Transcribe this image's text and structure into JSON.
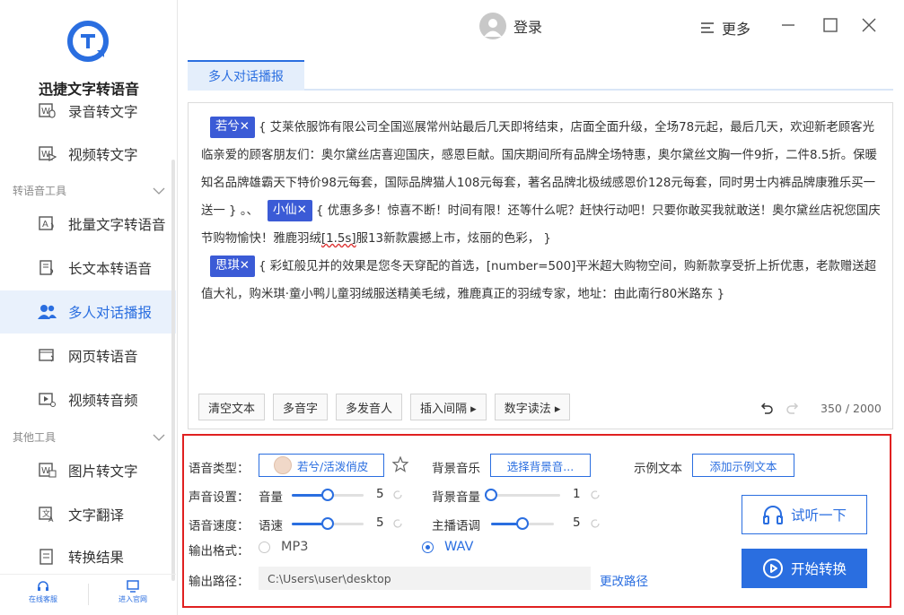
{
  "app": {
    "name": "迅捷文字转语音"
  },
  "header": {
    "login_label": "登录",
    "more_label": "更多"
  },
  "sidebar": {
    "items_top": [
      {
        "label": "录音转文字",
        "icon": "record-to-text-icon"
      },
      {
        "label": "视频转文字",
        "icon": "video-to-text-icon"
      }
    ],
    "section1": "转语音工具",
    "items_tts": [
      {
        "label": "批量文字转语音",
        "icon": "batch-tts-icon"
      },
      {
        "label": "长文本转语音",
        "icon": "long-text-icon"
      },
      {
        "label": "多人对话播报",
        "icon": "multi-speaker-icon",
        "active": true
      },
      {
        "label": "网页转语音",
        "icon": "web-tts-icon"
      },
      {
        "label": "视频转音频",
        "icon": "video-audio-icon"
      }
    ],
    "section2": "其他工具",
    "items_other": [
      {
        "label": "图片转文字",
        "icon": "image-text-icon"
      },
      {
        "label": "文字翻译",
        "icon": "translate-icon"
      },
      {
        "label": "转换结果",
        "icon": "results-icon"
      }
    ],
    "bottom": {
      "service": "在线客服",
      "website": "进入官网"
    }
  },
  "tab": {
    "label": "多人对话播报"
  },
  "editor": {
    "segments": [
      {
        "speaker": "若兮✕",
        "text": "{ 艾莱依服饰有限公司全国巡展常州站最后几天即将结束，店面全面升级，全场78元起，最后几天，欢迎新老顾客光临亲爱的顾客朋友们：奥尔黛丝店喜迎国庆，感恩巨献。国庆期间所有品牌全场特惠，奥尔黛丝文胸一件9折，二件8.5折。保暖知名品牌雄霸天下特价98元每套，国际品牌猫人108元每套，著名品牌北极绒感恩价128元每套，同时男士内裤品牌康雅乐买一送一 } 。、"
      },
      {
        "speaker": "小仙✕",
        "text_a": "{ 优惠多多！惊喜不断！时间有限！还等什么呢？赶快行动吧！只要你敢买我就敢送！奥尔黛丝店祝您国庆节购物愉快！雅鹿羽绒",
        "mark": "[1.5s]",
        "text_b": "服13新款震撼上市，炫丽的色彩， }"
      },
      {
        "speaker": "思琪✕",
        "text": "{ 彩虹般见并的效果是您冬天穿配的首选，[number=500]平米超大购物空间，购新款享受折上折优惠，老款赠送超值大礼，购米琪·童小鸭儿童羽绒服送精美毛绒，雅鹿真正的羽绒专家，地址：由此南行80米路东 }"
      }
    ],
    "tools": [
      "清空文本",
      "多音字",
      "多发音人",
      "插入间隔 ▸",
      "数字读法 ▸"
    ],
    "counter": "350 / 2000"
  },
  "settings": {
    "voice_type_label": "语音类型：",
    "voice_selected": "若兮/活泼俏皮",
    "bg_music_label": "背景音乐",
    "bg_music_button": "选择背景音...",
    "sample_label": "示例文本",
    "sample_button": "添加示例文本",
    "sound_label": "声音设置：",
    "volume_label": "音量",
    "volume_value": "5",
    "volume_level": 0.5,
    "bg_volume_label": "背景音量",
    "bg_volume_value": "1",
    "bg_volume_level": 0.0,
    "speed_label": "语音速度：",
    "rate_label": "语速",
    "rate_value": "5",
    "rate_level": 0.5,
    "pitch_label": "主播语调",
    "pitch_value": "5",
    "pitch_level": 0.5,
    "format_label": "输出格式：",
    "formats": [
      "MP3",
      "WAV"
    ],
    "format_selected": "WAV",
    "path_label": "输出路径：",
    "path_value": "C:\\Users\\user\\desktop",
    "change_path": "更改路径",
    "listen_button": "试听一下",
    "start_button": "开始转换"
  },
  "colors": {
    "accent": "#2a6ee0",
    "speaker_tag": "#3b5bd6",
    "highlight_border": "#e02020"
  }
}
